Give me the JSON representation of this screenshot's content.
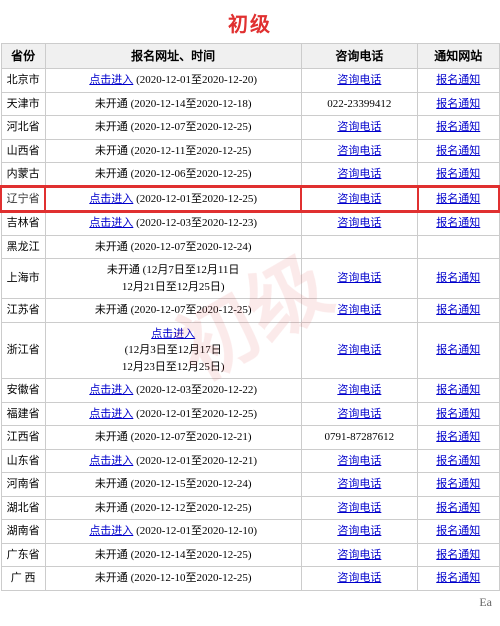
{
  "title": "初级",
  "watermark": "初级",
  "headers": {
    "province": "省份",
    "registration": "报名网址、时间",
    "phone": "咨询电话",
    "notice": "通知网站"
  },
  "rows": [
    {
      "province": "北京市",
      "reg_link": "点击进入",
      "reg_time": "(2020-12-01至2020-12-20)",
      "phone_link": "咨询电话",
      "notice_link": "报名通知",
      "highlighted": false
    },
    {
      "province": "天津市",
      "reg_link": "未开通",
      "reg_time": "(2020-12-14至2020-12-18)",
      "phone_text": "022-23399412",
      "notice_link": "报名通知",
      "highlighted": false
    },
    {
      "province": "河北省",
      "reg_link": "未开通",
      "reg_time": "(2020-12-07至2020-12-25)",
      "phone_link": "咨询电话",
      "notice_link": "报名通知",
      "highlighted": false
    },
    {
      "province": "山西省",
      "reg_link": "未开通",
      "reg_time": "(2020-12-11至2020-12-25)",
      "phone_link": "咨询电话",
      "notice_link": "报名通知",
      "highlighted": false
    },
    {
      "province": "内蒙古",
      "reg_link": "未开通",
      "reg_time": "(2020-12-06至2020-12-25)",
      "phone_link": "咨询电话",
      "notice_link": "报名通知",
      "highlighted": false
    },
    {
      "province": "辽宁省",
      "reg_link": "点击进入",
      "reg_time": "(2020-12-01至2020-12-25)",
      "phone_link": "咨询电话",
      "notice_link": "报名通知",
      "highlighted": true
    },
    {
      "province": "吉林省",
      "reg_link": "点击进入",
      "reg_time": "(2020-12-03至2020-12-23)",
      "phone_link": "咨询电话",
      "notice_link": "报名通知",
      "highlighted": false
    },
    {
      "province": "黑龙江",
      "reg_link": "未开通",
      "reg_time": "(2020-12-07至2020-12-24)",
      "phone_link": "",
      "notice_link": "",
      "highlighted": false
    },
    {
      "province": "上海市",
      "reg_link": "未开通",
      "reg_time": "(12月7日至12月11日\n12月21日至12月25日)",
      "phone_link": "咨询电话",
      "notice_link": "报名通知",
      "highlighted": false
    },
    {
      "province": "江苏省",
      "reg_link": "未开通",
      "reg_time": "(2020-12-07至2020-12-25)",
      "phone_link": "咨询电话",
      "notice_link": "报名通知",
      "highlighted": false
    },
    {
      "province": "浙江省",
      "reg_link2": "点击进入",
      "reg_time": "(12月3日至12月17日\n12月23日至12月25日)",
      "phone_link": "咨询电话",
      "notice_link": "报名通知",
      "highlighted": false,
      "special": true
    },
    {
      "province": "安徽省",
      "reg_link": "点击进入",
      "reg_time": "(2020-12-03至2020-12-22)",
      "phone_link": "咨询电话",
      "notice_link": "报名通知",
      "highlighted": false
    },
    {
      "province": "福建省",
      "reg_link": "点击进入",
      "reg_time": "(2020-12-01至2020-12-25)",
      "phone_link": "咨询电话",
      "notice_link": "报名通知",
      "highlighted": false
    },
    {
      "province": "江西省",
      "reg_link": "未开通",
      "reg_time": "(2020-12-07至2020-12-21)",
      "phone_text": "0791-87287612",
      "notice_link": "报名通知",
      "highlighted": false
    },
    {
      "province": "山东省",
      "reg_link": "点击进入",
      "reg_time": "(2020-12-01至2020-12-21)",
      "phone_link": "咨询电话",
      "notice_link": "报名通知",
      "highlighted": false
    },
    {
      "province": "河南省",
      "reg_link": "未开通",
      "reg_time": "(2020-12-15至2020-12-24)",
      "phone_link": "咨询电话",
      "notice_link": "报名通知",
      "highlighted": false
    },
    {
      "province": "湖北省",
      "reg_link": "未开通",
      "reg_time": "(2020-12-12至2020-12-25)",
      "phone_link": "咨询电话",
      "notice_link": "报名通知",
      "highlighted": false
    },
    {
      "province": "湖南省",
      "reg_link": "点击进入",
      "reg_time": "(2020-12-01至2020-12-10)",
      "phone_link": "咨询电话",
      "notice_link": "报名通知",
      "highlighted": false
    },
    {
      "province": "广东省",
      "reg_link": "未开通",
      "reg_time": "(2020-12-14至2020-12-25)",
      "phone_link": "咨询电话",
      "notice_link": "报名通知",
      "highlighted": false
    },
    {
      "province": "广 西",
      "reg_link": "未开通",
      "reg_time": "(2020-12-10至2020-12-25)",
      "phone_link": "咨询电话",
      "notice_link": "报名通知",
      "highlighted": false
    }
  ],
  "footer": "Ea"
}
